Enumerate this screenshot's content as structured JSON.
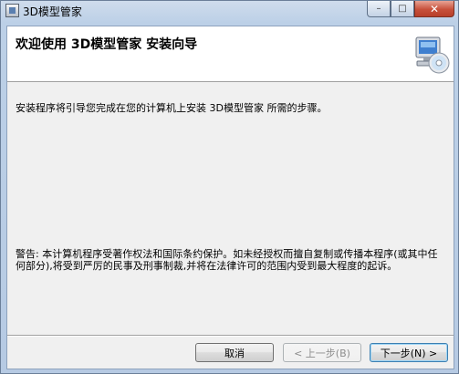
{
  "window": {
    "title": "3D模型管家",
    "caption_minimize": "–",
    "caption_maximize": "□",
    "caption_close": "✕"
  },
  "header": {
    "title": "欢迎使用  3D模型管家  安装向导",
    "graphic_icon": "computer-cd-icon"
  },
  "body": {
    "intro": "安装程序将引导您完成在您的计算机上安装 3D模型管家 所需的步骤。",
    "warning": "警告: 本计算机程序受著作权法和国际条约保护。如未经授权而擅自复制或传播本程序(或其中任何部分),将受到严厉的民事及刑事制裁,并将在法律许可的范围内受到最大程度的起诉。"
  },
  "buttons": {
    "cancel": "取消",
    "back": "< 上一步(B)",
    "next": "下一步(N) >"
  }
}
